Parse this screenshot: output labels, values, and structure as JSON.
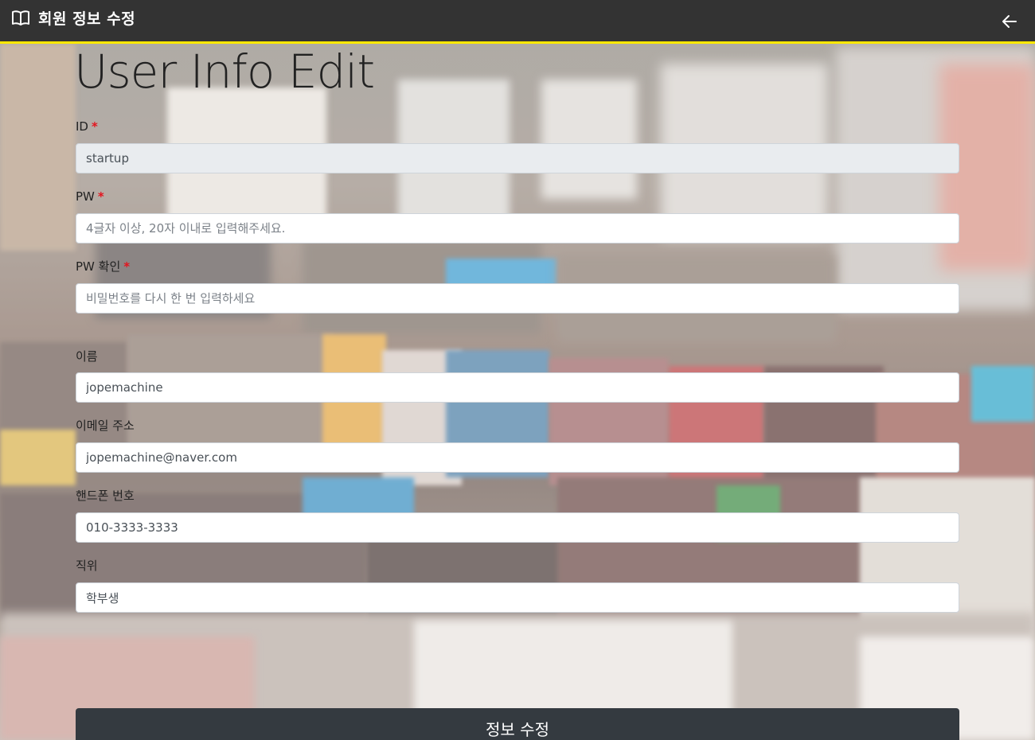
{
  "header": {
    "title": "회원 정보 수정",
    "logo_icon": "open-book-icon",
    "back_icon": "arrow-left-icon",
    "bar_color": "#333333",
    "accent_color": "#ffe800"
  },
  "page_title": "User Info Edit",
  "form": {
    "id": {
      "label": "ID",
      "required_mark": "*",
      "value": "startup"
    },
    "pw": {
      "label": "PW",
      "required_mark": "*",
      "placeholder": "4글자 이상, 20자 이내로 입력해주세요.",
      "value": ""
    },
    "pw_confirm": {
      "label": "PW 확인",
      "required_mark": "*",
      "placeholder": "비밀번호를 다시 한 번 입력하세요",
      "value": ""
    },
    "name": {
      "label": "이름",
      "value": "jopemachine"
    },
    "email": {
      "label": "이메일 주소",
      "value": "jopemachine@naver.com"
    },
    "phone": {
      "label": "핸드폰 번호",
      "value": "010-3333-3333"
    },
    "position": {
      "label": "직위",
      "value": "학부생"
    },
    "submit_label": "정보 수정"
  }
}
